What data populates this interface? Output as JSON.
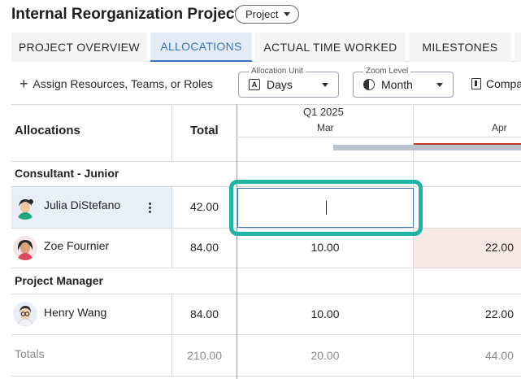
{
  "header": {
    "title": "Internal Reorganization Project",
    "chip_label": "Project"
  },
  "tabs": [
    {
      "label": "PROJECT OVERVIEW",
      "active": false
    },
    {
      "label": "ALLOCATIONS",
      "active": true
    },
    {
      "label": "ACTUAL TIME WORKED",
      "active": false
    },
    {
      "label": "MILESTONES",
      "active": false
    }
  ],
  "toolbar": {
    "assign_label": "Assign Resources, Teams, or Roles",
    "allocation_unit": {
      "label": "Allocation Unit",
      "value": "Days"
    },
    "zoom_level": {
      "label": "Zoom Level",
      "value": "Month"
    },
    "compare_label": "Compa"
  },
  "grid": {
    "col_allocations": "Allocations",
    "col_total": "Total",
    "quarter": "Q1 2025",
    "months": [
      "Mar",
      "Apr"
    ],
    "groups": [
      {
        "name": "Consultant - Junior",
        "rows": [
          {
            "name": "Julia DiStefano",
            "total": "42.00",
            "mar": "",
            "apr": "",
            "avatar": "avatar-icon"
          },
          {
            "name": "Zoe Fournier",
            "total": "84.00",
            "mar": "10.00",
            "apr": "22.00",
            "avatar": "avatar-icon"
          }
        ]
      },
      {
        "name": "Project Manager",
        "rows": [
          {
            "name": "Henry Wang",
            "total": "84.00",
            "mar": "10.00",
            "apr": "22.00",
            "avatar": "avatar-icon"
          }
        ]
      }
    ],
    "totals": {
      "label": "Totals",
      "total": "210.00",
      "mar": "20.00",
      "apr": "44.00"
    }
  },
  "colors": {
    "accent": "#3b73b7",
    "focus_ring": "#1fb4a5",
    "over_alloc": "#c0392b"
  }
}
